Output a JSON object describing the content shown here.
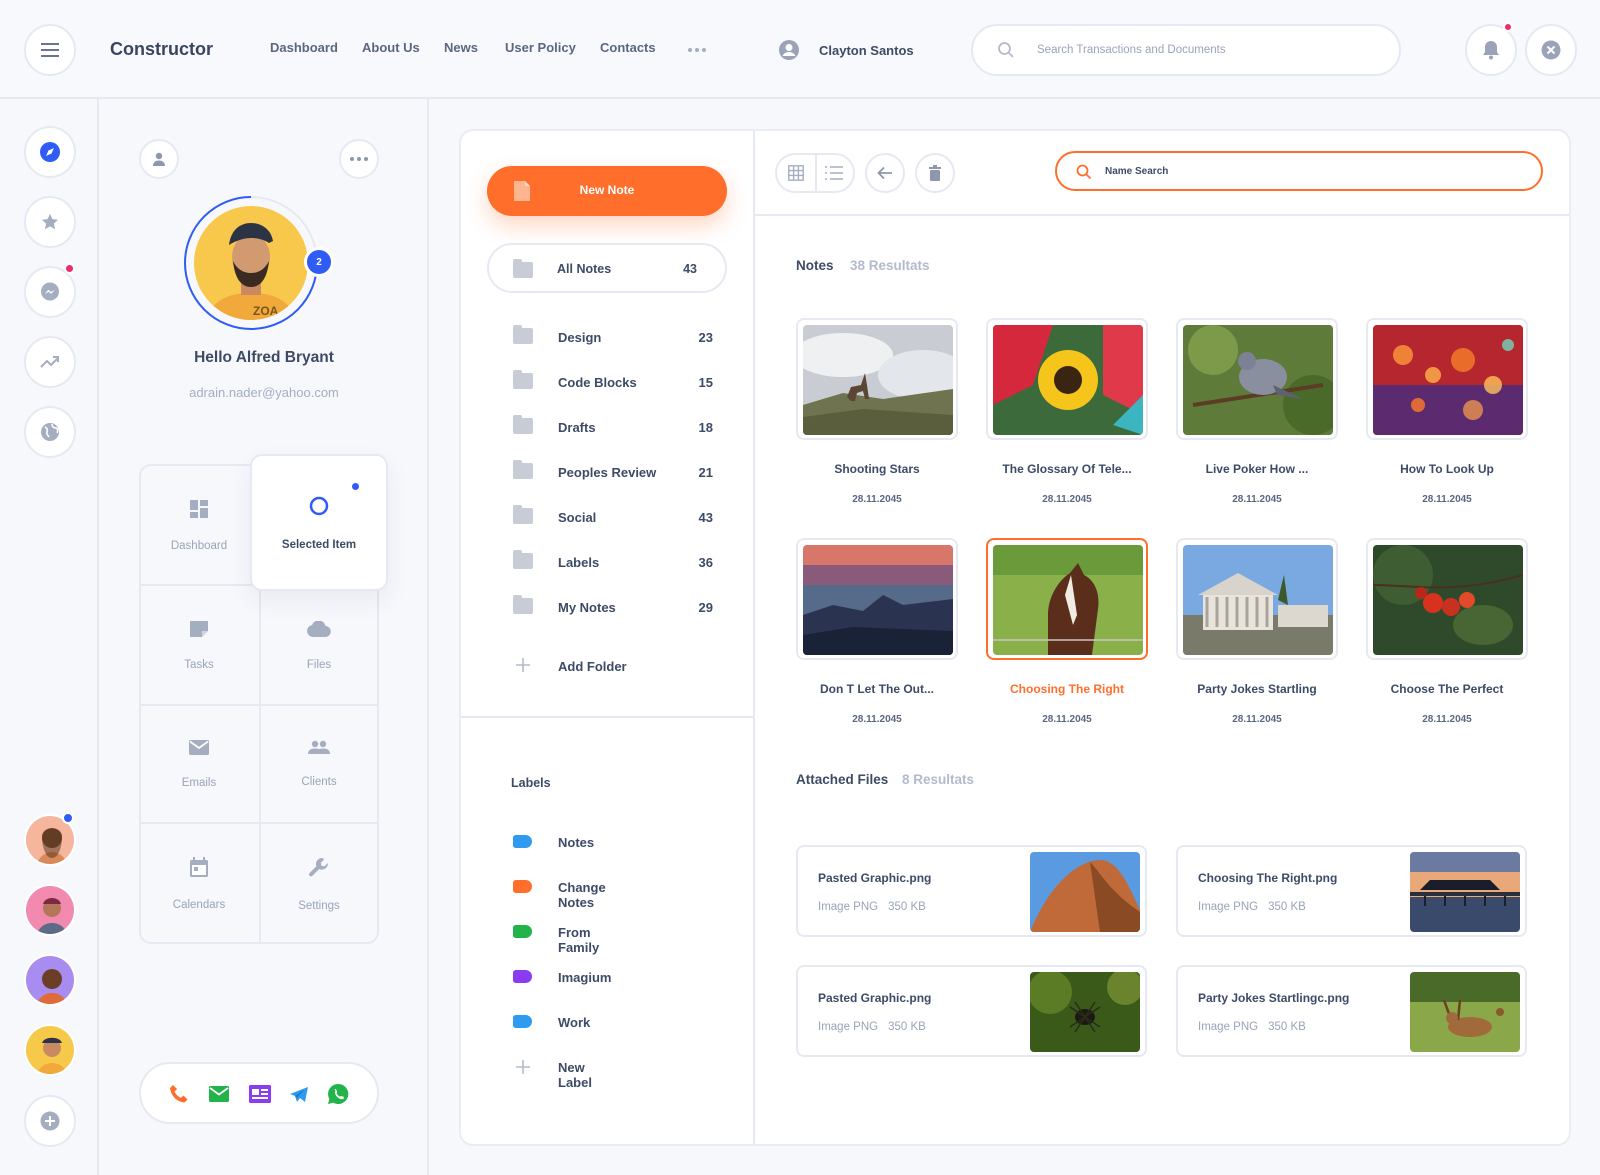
{
  "topbar": {
    "brand": "Constructor",
    "nav": [
      "Dashboard",
      "About Us",
      "News",
      "User Policy",
      "Contacts"
    ],
    "user_name": "Clayton Santos",
    "search_placeholder": "Search Transactions and Documents"
  },
  "profile": {
    "greeting": "Hello Alfred Bryant",
    "email": "adrain.nader@yahoo.com",
    "avatar_badge": "2",
    "tiles": [
      "Dashboard",
      "Selected Item",
      "Tasks",
      "Files",
      "Emails",
      "Clients",
      "Calendars",
      "Settings"
    ]
  },
  "notes_panel": {
    "new_note": "New Note",
    "all_notes": {
      "label": "All Notes",
      "count": "43"
    },
    "folders": [
      {
        "label": "Design",
        "count": "23"
      },
      {
        "label": "Code Blocks",
        "count": "15"
      },
      {
        "label": "Drafts",
        "count": "18"
      },
      {
        "label": "Peoples Review",
        "count": "21"
      },
      {
        "label": "Social",
        "count": "43"
      },
      {
        "label": "Labels",
        "count": "36"
      },
      {
        "label": "My Notes",
        "count": "29"
      }
    ],
    "add_folder": "Add Folder",
    "labels_title": "Labels",
    "labels": [
      {
        "label": "Notes",
        "color": "#2e9bf0"
      },
      {
        "label": "Change Notes",
        "color": "#ff6e2b"
      },
      {
        "label": "From Family",
        "color": "#22b34a"
      },
      {
        "label": "Imagium",
        "color": "#8a3cf0"
      },
      {
        "label": "Work",
        "color": "#2e9bf0"
      }
    ],
    "new_label": "New Label"
  },
  "content": {
    "name_search_placeholder": "Name Search",
    "notes_title": "Notes",
    "notes_count": "38 Resultats",
    "notes": [
      {
        "title": "Shooting Stars",
        "date": "28.11.2045"
      },
      {
        "title": "The Glossary Of Tele...",
        "date": "28.11.2045"
      },
      {
        "title": "Live Poker How ...",
        "date": "28.11.2045"
      },
      {
        "title": "How To Look Up",
        "date": "28.11.2045"
      },
      {
        "title": "Don T Let The Out...",
        "date": "28.11.2045"
      },
      {
        "title": "Choosing The Right",
        "date": "28.11.2045"
      },
      {
        "title": "Party Jokes Startling",
        "date": "28.11.2045"
      },
      {
        "title": "Choose The Perfect",
        "date": "28.11.2045"
      }
    ],
    "files_title": "Attached Files",
    "files_count": "8 Resultats",
    "files": [
      {
        "name": "Pasted Graphic.png",
        "type": "Image PNG",
        "size": "350 KB"
      },
      {
        "name": "Choosing The Right.png",
        "type": "Image PNG",
        "size": "350 KB"
      },
      {
        "name": "Pasted Graphic.png",
        "type": "Image PNG",
        "size": "350 KB"
      },
      {
        "name": "Party Jokes Startlingc.png",
        "type": "Image PNG",
        "size": "350 KB"
      }
    ]
  },
  "colors": {
    "accent": "#ff6e2b",
    "primary": "#2f5cf5",
    "alert": "#ee2b6b"
  }
}
